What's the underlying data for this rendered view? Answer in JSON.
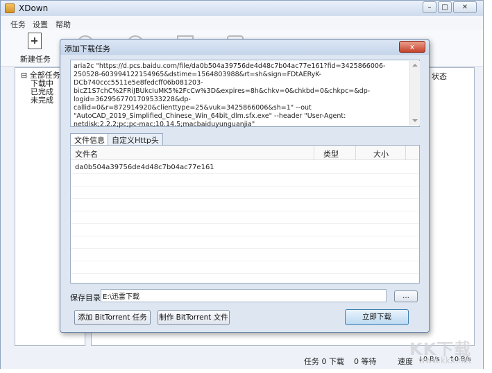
{
  "window": {
    "title": "XDown",
    "min_glyph": "–",
    "max_glyph": "□",
    "close_glyph": "✕"
  },
  "menu": [
    "任务",
    "设置",
    "帮助"
  ],
  "toolbar": {
    "new_task_label": "新建任务"
  },
  "tree": {
    "items": [
      "全部任务",
      "下载中",
      "已完成",
      "未完成"
    ]
  },
  "list": {
    "status_header": "状态"
  },
  "statusbar": {
    "tasks": "任务 0 下载",
    "waiting": "0 等待",
    "speed_label": "速度",
    "down_speed": "↓0 B/s",
    "up_speed": "↑0 B/s"
  },
  "dialog": {
    "title": "添加下载任务",
    "close_glyph": "x",
    "command": "aria2c \"https://d.pcs.baidu.com/file/da0b504a39756de4d48c7b04ac77e161?fid=3425866006-250528-603994122154965&dstime=1564803988&rt=sh&sign=FDtAERyK-DCb740ccc5511e5e8fedcff06b081203-bicZ1S7chC%2FRiJBUkcIuMK5%2FcCw%3D&expires=8h&chkv=0&chkbd=0&chkpc=&dp-logid=3629567701709533228&dp-callid=0&r=872914920&clienttype=25&vuk=3425866006&sh=1\" --out \"AutoCAD_2019_Simplified_Chinese_Win_64bit_dlm.sfx.exe\" --header \"User-Agent: netdisk;2.2.2;pc;pc-mac;10.14.5;macbaiduyunguanjia\"",
    "tabs": [
      "文件信息",
      "自定义Http头"
    ],
    "table": {
      "headers": {
        "name": "文件名",
        "type": "类型",
        "size": "大小"
      },
      "rows": [
        {
          "name": "da0b504a39756de4d48c7b04ac77e161",
          "type": "",
          "size": ""
        }
      ]
    },
    "save_dir_label": "保存目录",
    "save_dir_value": "E:\\迅雷下载",
    "browse_label": "...",
    "buttons": {
      "add_bt": "添加 BitTorrent 任务",
      "make_bt": "制作 BitTorrent 文件",
      "download": "立即下载"
    }
  },
  "watermark": {
    "text": "KK下载",
    "url": "www.kkx.net"
  }
}
